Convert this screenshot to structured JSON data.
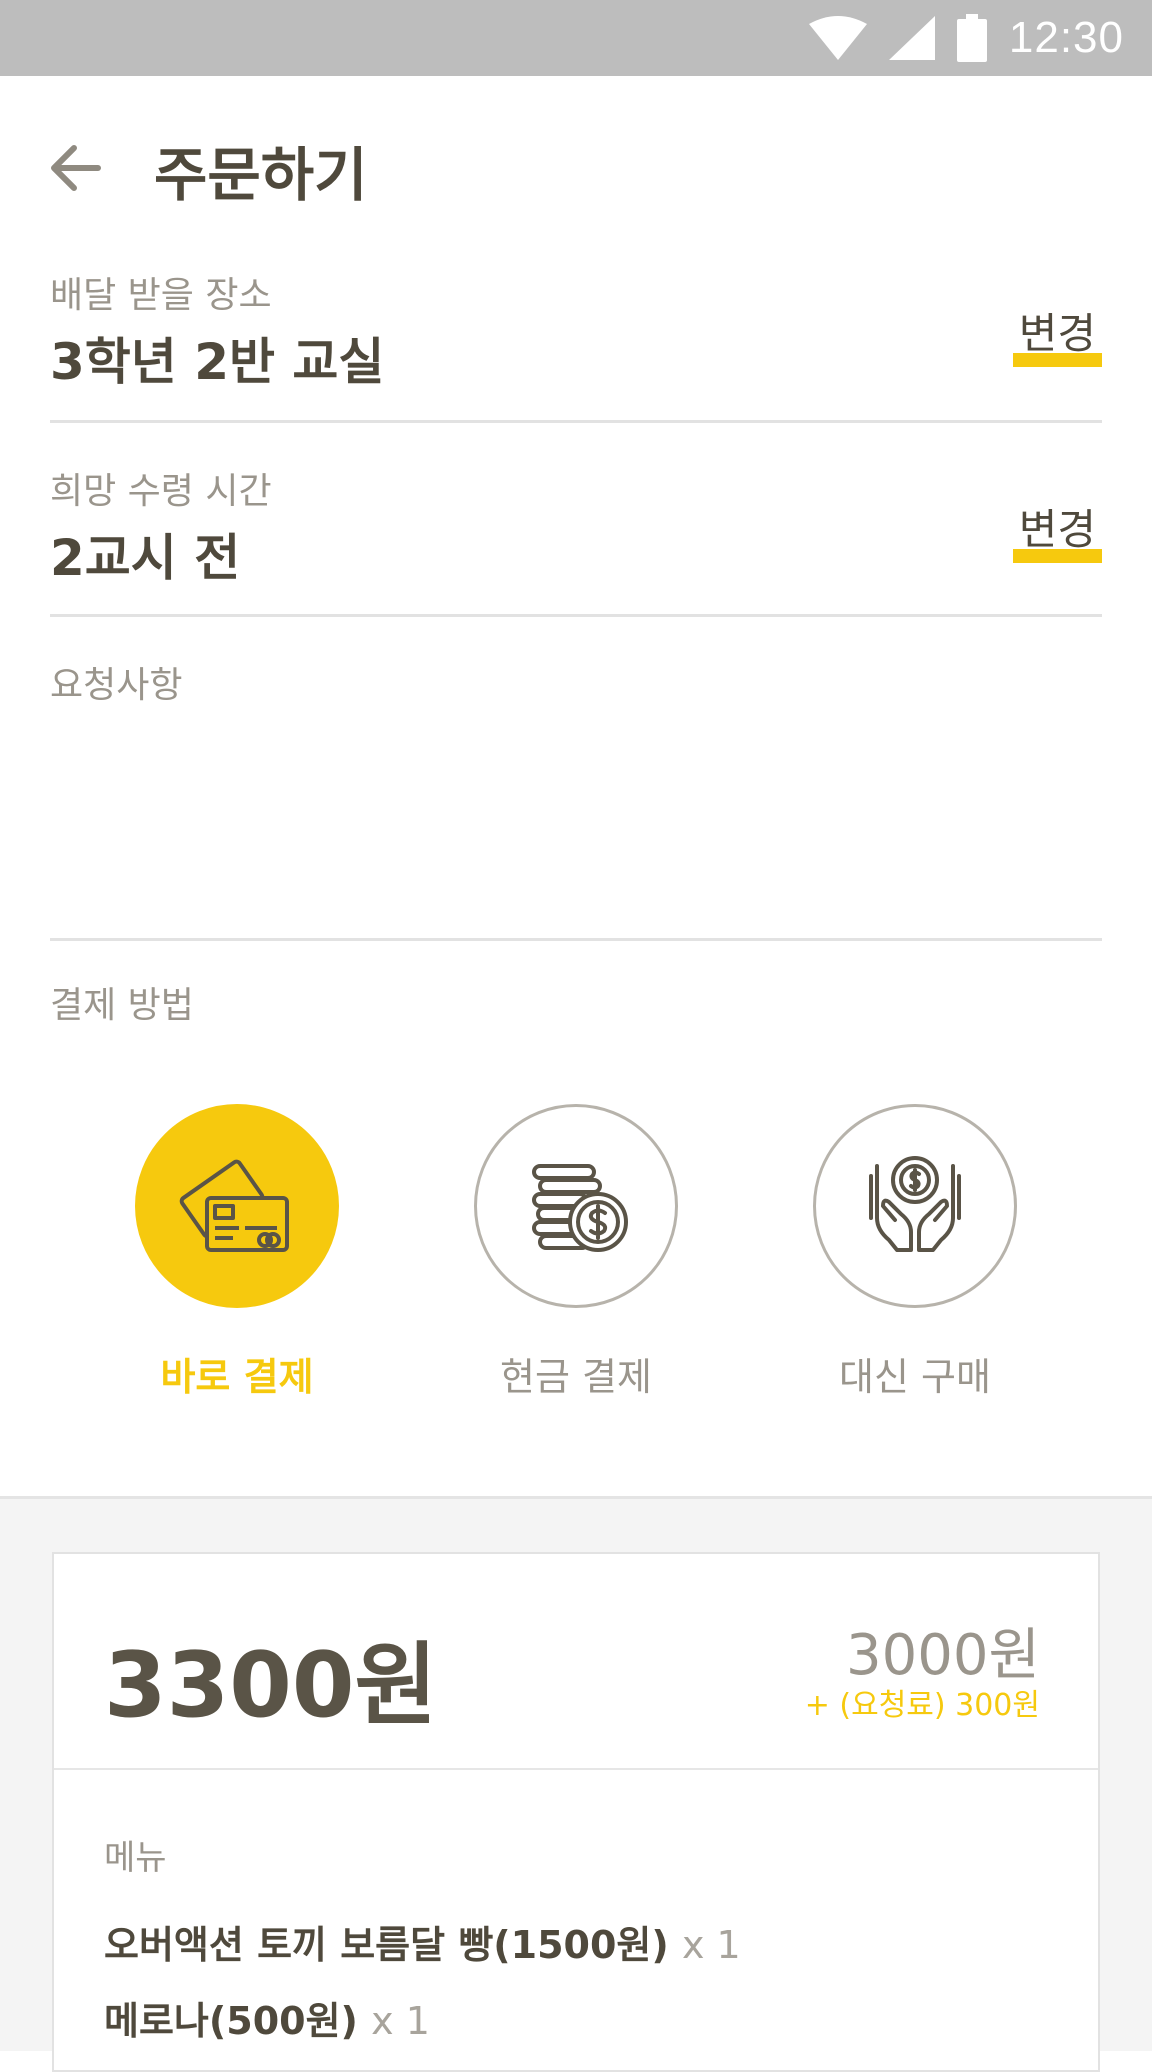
{
  "status_bar": {
    "time": "12:30",
    "icons": [
      "wifi-icon",
      "signal-icon",
      "battery-icon"
    ]
  },
  "header": {
    "title": "주문하기",
    "back_icon": "arrow-left-icon"
  },
  "delivery": {
    "label": "배달 받을 장소",
    "value": "3학년 2반 교실",
    "change_label": "변경"
  },
  "pickup_time": {
    "label": "희망 수령 시간",
    "value": "2교시 전",
    "change_label": "변경"
  },
  "request": {
    "label": "요청사항",
    "value": ""
  },
  "payment": {
    "label": "결제 방법",
    "options": [
      {
        "label": "바로 결제",
        "icon": "credit-card-icon",
        "selected": true
      },
      {
        "label": "현금 결제",
        "icon": "coins-icon",
        "selected": false
      },
      {
        "label": "대신 구매",
        "icon": "hands-coin-icon",
        "selected": false
      }
    ]
  },
  "summary": {
    "total": "3300원",
    "subtotal": "3000원",
    "fee": "+ (요청료) 300원",
    "menu_label": "메뉴",
    "items": [
      {
        "name": "오버액션 토끼 보름달 빵(1500원)",
        "qty": "x 1"
      },
      {
        "name": "메로나(500원)",
        "qty": "x 1"
      }
    ]
  },
  "colors": {
    "accent": "#f6c90e",
    "text_dark": "#4f493c",
    "text_muted": "#9a958c",
    "status_bar": "#bdbdbd"
  }
}
